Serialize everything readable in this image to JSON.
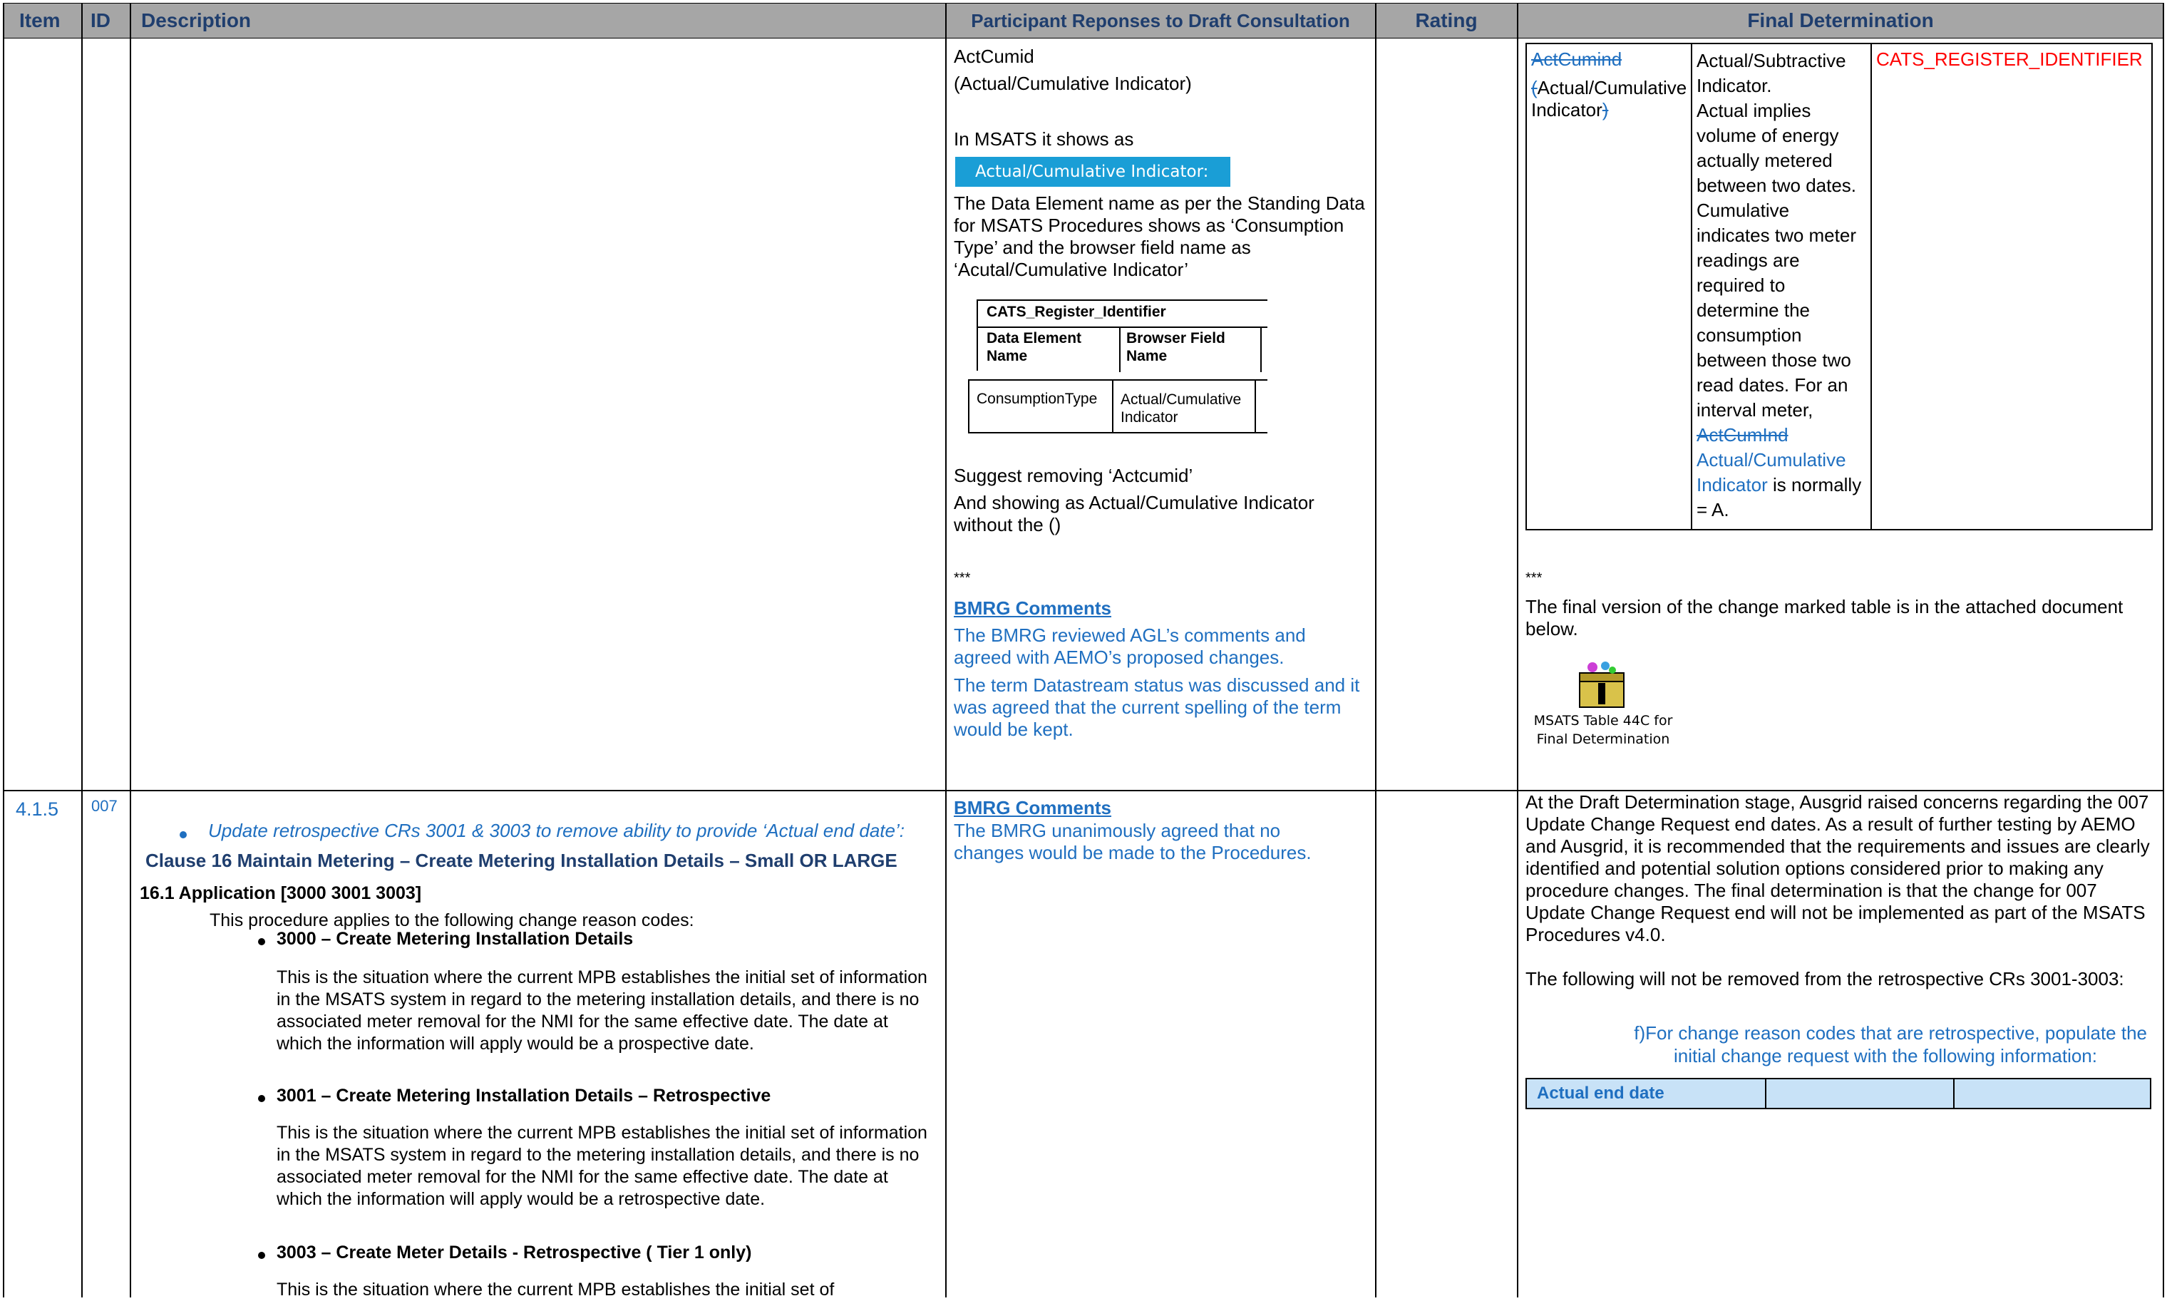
{
  "header": {
    "item": "Item",
    "id": "ID",
    "description": "Description",
    "responses": "Participant Reponses to Draft Consultation",
    "rating": "Rating",
    "final": "Final Determination"
  },
  "row1": {
    "responses": {
      "actcumid": "ActCumid",
      "actcumid_desc": "(Actual/Cumulative Indicator)",
      "msats_shows": "In MSATS it shows as",
      "banner": "Actual/Cumulative Indicator:",
      "para1": "The Data Element name as per the Standing Data for MSATS Procedures shows as ‘Consumption Type’ and the browser field name as ‘Acutal/Cumulative Indicator’",
      "table_title": "CATS_Register_Identifier",
      "table_col1": "Data Element Name",
      "table_col2": "Browser Field Name",
      "table_row_col1": "ConsumptionType",
      "table_row_col2": "Actual/Cumulative Indicator",
      "suggest": "Suggest removing ‘Actcumid’",
      "suggest2": "And showing as Actual/Cumulative Indicator without the ()",
      "stars": "***",
      "bmrg_heading": "BMRG Comments",
      "bmrg1": "The BMRG reviewed AGL’s comments and agreed with AEMO’s proposed changes.",
      "bmrg2": "The term Datastream status was discussed and it was agreed that the current spelling of the term would be kept."
    },
    "final": {
      "col1_strike": "ActCumind",
      "col1_open": "(",
      "col1_name": "Actual/Cumulative Indicator",
      "col1_close": ")",
      "col2_lines": [
        "Actual/Subtractive",
        "Indicator.",
        "Actual implies",
        "volume of energy",
        "actually metered",
        "between two dates.",
        "Cumulative",
        "indicates two meter",
        "readings are",
        "required to",
        "determine the",
        "consumption",
        "between those two",
        "read dates. For an",
        "interval meter,"
      ],
      "col2_strike": "ActCumInd",
      "col2_new1": "Actual/Cumulative",
      "col2_new2": "Indicator",
      "col2_tail": " is normally",
      "col2_last": "= A.",
      "col3": "CATS_REGISTER_IDENTIFIER",
      "stars": "***",
      "final_note": "The final version of the change marked table is in the attached document below.",
      "attachment_label_1": "MSATS Table 44C for",
      "attachment_label_2": "Final Determination"
    }
  },
  "row2": {
    "item": "4.1.5",
    "id": "007",
    "desc": {
      "bullet_italic": "Update retrospective CRs 3001 & 3003 to remove ability to provide ‘Actual end date’:",
      "clause": "Clause 16 Maintain Metering – Create Metering Installation Details – Small OR LARGE",
      "app": "16.1 Application [3000 3001 3003]",
      "applies": "This procedure applies to the following change reason codes:",
      "b1": "3000 – Create Metering Installation Details",
      "p1": "This is the situation where the current MPB establishes the initial set of information in the MSATS system in regard to the metering installation details, and there is no associated meter removal for the NMI for the same effective date.  The date at which the information will apply would be a prospective date.",
      "b2": "3001 – Create Metering Installation Details – Retrospective",
      "p2": "This is the situation where the current MPB establishes the initial set of information in the MSATS system in regard to the metering installation details, and there is no associated meter removal for the NMI for the same effective date. The date at which the information will apply would be a retrospective date.",
      "b3": "3003 – Create Meter Details - Retrospective ( Tier 1 only)",
      "p3": "This is the situation where the current MPB establishes the initial set of"
    },
    "responses": {
      "bmrg_heading": "BMRG Comments",
      "bmrg": "The BMRG unanimously agreed that no changes would be made to the Procedures."
    },
    "final": {
      "para1": "At the Draft Determination stage, Ausgrid raised concerns regarding the 007 Update Change Request end dates. As a result of further testing by AEMO and Ausgrid, it is recommended that the requirements and issues are clearly identified and potential solution options considered prior to making any procedure changes. The final determination is that the change for 007 Update Change Request end will not be implemented as part of the MSATS Procedures v4.0.",
      "para2": "The following will not be removed from the retrospective CRs 3001-3003:",
      "blue_line1": "f)For change reason codes that are retrospective, populate the",
      "blue_line2": "initial change request with the following information:",
      "table_cell": "Actual end date"
    }
  }
}
